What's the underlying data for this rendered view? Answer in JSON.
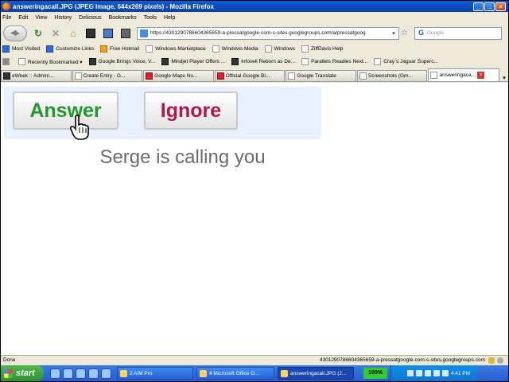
{
  "window": {
    "title": "answeringacall.JPG (JPEG Image, 644x269 pixels) - Mozilla Firefox",
    "controls": {
      "minimize": "_",
      "maximize": "□",
      "close": "×"
    }
  },
  "menu": [
    "File",
    "Edit",
    "View",
    "History",
    "Delicious",
    "Bookmarks",
    "Tools",
    "Help"
  ],
  "nav": {
    "url": "https://4301290786604365659-a-pressatgoogle-com-s-sites.googlegroups.com/a/pressatgoog",
    "search_placeholder": "Google"
  },
  "bookmarks_row1": [
    "Most Visited",
    "Customize Links",
    "Free Hotmail",
    "Windows Marketplace",
    "Windows Media",
    "Windows",
    "ZiffDavis Help"
  ],
  "bookmarks_row2": [
    "Recently Bookmarked ▾",
    "Google Brings Voice, V...",
    "Mindjet Player Offers ...",
    "Infovell Reborn as De...",
    "Parallels Readies Next...",
    "Cray`s Jaguar Superc..."
  ],
  "tabs": [
    "eWeek :: Admini...",
    "Create Entry - G...",
    "Google Maps No...",
    "Official Google Bl...",
    "Google Translate",
    "Screenshots (Gm...",
    "answeringaca..."
  ],
  "content": {
    "answer_label": "Answer",
    "ignore_label": "Ignore",
    "calling_text": "Serge is calling you"
  },
  "status": {
    "text": "Done",
    "url": "4301290786604365659-a-pressatgoogle-com-s-sites.googlegroups.com"
  },
  "taskbar": {
    "start": "start",
    "tasks": [
      "2 AIM Pro",
      "4 Microsoft Office O...",
      "answeringacall.JPG (J..."
    ],
    "zoom": "100%",
    "clock": "4:41 PM"
  }
}
